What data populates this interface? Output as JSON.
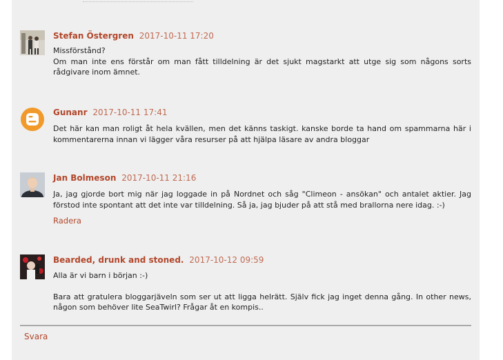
{
  "comments": [
    {
      "author": "Stefan Östergren",
      "timestamp": "2017-10-11 17:20",
      "avatar": "photo-avatar",
      "lines": [
        "Missförstånd?",
        "Om man inte ens förstår om man fått tilldelning är det sjukt magstarkt att utge sig som någons sorts rådgivare inom ämnet."
      ]
    },
    {
      "author": "Gunanr",
      "timestamp": "2017-10-11 17:41",
      "avatar": "blogger-icon",
      "lines": [
        "Det här kan man roligt åt hela kvällen, men det känns taskigt. kanske borde ta hand om spammarna här i kommentarerna innan vi lägger våra resurser på att hjälpa läsare av andra bloggar"
      ]
    },
    {
      "author": "Jan Bolmeson",
      "timestamp": "2017-10-11 21:16",
      "avatar": "photo-avatar",
      "lines": [
        "Ja, jag gjorde bort mig när jag loggade in på Nordnet och såg \"Climeon - ansökan\" och antalet aktier. Jag förstod inte spontant att det inte var tilldelning. Så ja, jag bjuder på att stå med brallorna nere idag. :-)"
      ],
      "delete_label": "Radera"
    },
    {
      "author": "Bearded, drunk and stoned.",
      "timestamp": "2017-10-12 09:59",
      "avatar": "photo-avatar",
      "lines": [
        "Alla är vi barn i början :-)",
        "Bara att gratulera bloggarjäveln som ser ut att ligga helrätt. Själv fick jag inget denna gång. In other news, någon som behöver lite SeaTwirl? Frågar åt en kompis.."
      ]
    }
  ],
  "reply_label": "Svara",
  "colors": {
    "link": "#b2462a",
    "timestamp": "#c06a52",
    "panel": "#efefef",
    "blogger_orange": "#f19a2b"
  }
}
